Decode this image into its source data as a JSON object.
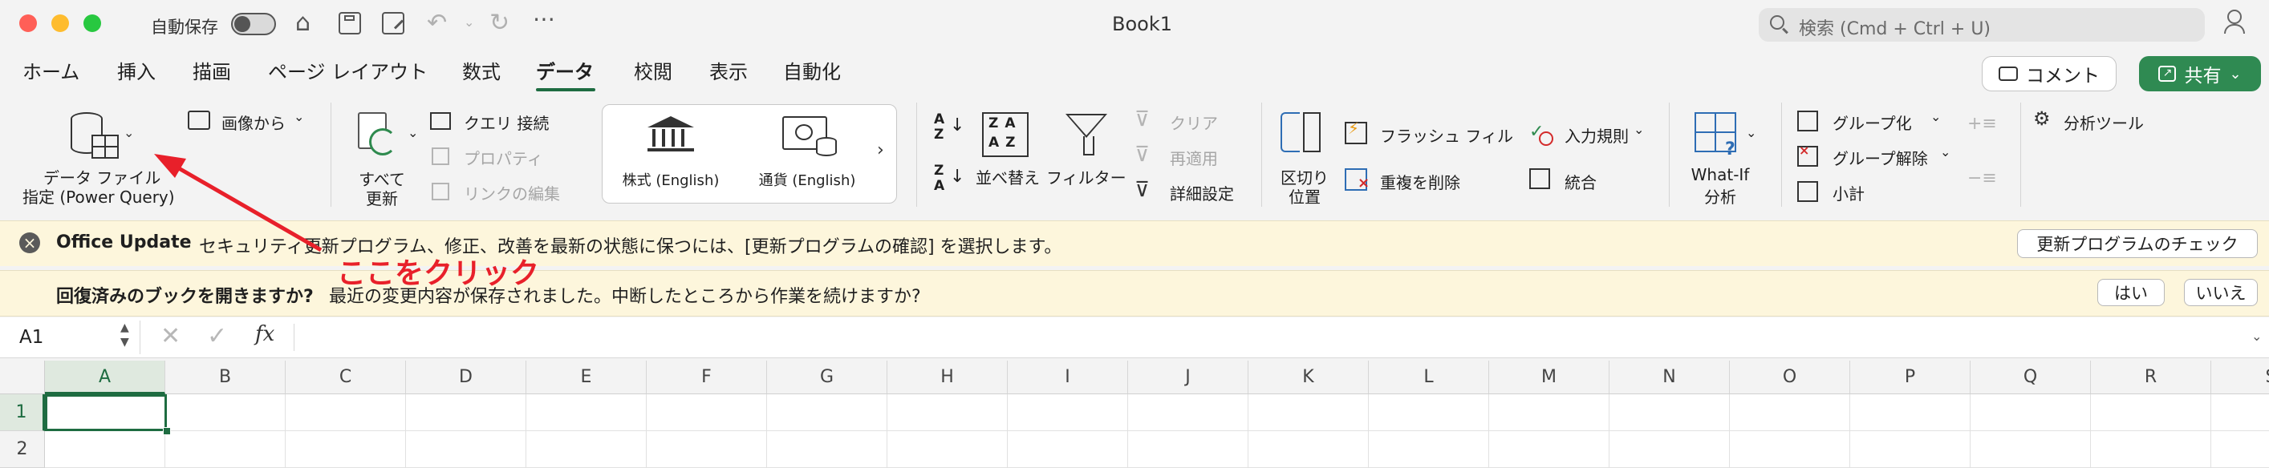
{
  "titlebar": {
    "autosave_label": "自動保存",
    "title": "Book1",
    "search_placeholder": "検索 (Cmd + Ctrl + U)",
    "colors": {
      "close": "#ff5f57",
      "minimize": "#febc2e",
      "zoom": "#28c840"
    }
  },
  "tabs": [
    "ホーム",
    "挿入",
    "描画",
    "ページ レイアウト",
    "数式",
    "データ",
    "校閲",
    "表示",
    "自動化"
  ],
  "active_tab": "データ",
  "header_buttons": {
    "comment": "コメント",
    "share": "共有"
  },
  "ribbon": {
    "get_data": {
      "line1": "データ ファイル",
      "line2": "指定 (Power Query)"
    },
    "from_picture": "画像から",
    "refresh_all": {
      "line1": "すべて",
      "line2": "更新"
    },
    "queries_connections": "クエリ  接続",
    "properties": "プロパティ",
    "edit_links": "リンクの編集",
    "stocks": "株式 (English)",
    "currencies": "通貨 (English)",
    "sort": "並べ替え",
    "filter": "フィルター",
    "clear": "クリア",
    "reapply": "再適用",
    "advanced": "詳細設定",
    "text_to_columns": {
      "line1": "区切り",
      "line2": "位置"
    },
    "flash_fill": "フラッシュ フィル",
    "remove_duplicates": "重複を削除",
    "data_validation": "入力規則",
    "consolidate": "統合",
    "what_if": {
      "line1": "What-If",
      "line2": "分析"
    },
    "group": "グループ化",
    "ungroup": "グループ解除",
    "subtotal": "小計",
    "analysis_tools": "分析ツール"
  },
  "update_bar": {
    "title": "Office Update",
    "message": "セキュリティ更新プログラム、修正、改善を最新の状態に保つには、[更新プログラムの確認] を選択します。",
    "button": "更新プログラムのチェック"
  },
  "recover_bar": {
    "title": "回復済みのブックを開きますか?",
    "message": "最近の変更内容が保存されました。中断したところから作業を続けますか?",
    "yes": "はい",
    "no": "いいえ"
  },
  "formula_bar": {
    "name_box": "A1",
    "fx": "fx",
    "value": ""
  },
  "columns": [
    "A",
    "B",
    "C",
    "D",
    "E",
    "F",
    "G",
    "H",
    "I",
    "J",
    "K",
    "L",
    "M",
    "N",
    "O",
    "P",
    "Q",
    "R",
    "S"
  ],
  "rows": [
    "1",
    "2"
  ],
  "annotation": {
    "text": "ここをクリック",
    "color": "#e8202a"
  },
  "colors": {
    "accent_green": "#1e6c41",
    "share_green": "#2f8a52",
    "bar_yellow": "#fdf6dc"
  }
}
